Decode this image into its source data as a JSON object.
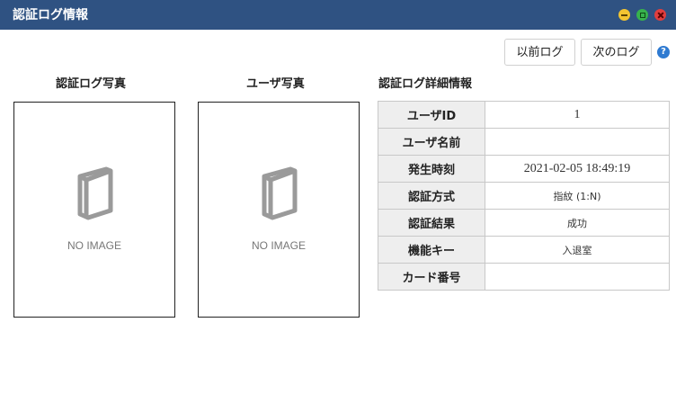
{
  "window": {
    "title": "認証ログ情報",
    "controls": [
      "minimize-icon",
      "maximize-icon",
      "close-icon"
    ]
  },
  "toolbar": {
    "prev_label": "以前ログ",
    "next_label": "次のログ",
    "help_label": "?"
  },
  "panels": {
    "auth_photo_title": "認証ログ写真",
    "user_photo_title": "ユーザ写真",
    "detail_title": "認証ログ詳細情報",
    "no_image": "NO IMAGE"
  },
  "details": [
    {
      "label": "ユーザID",
      "value": "1"
    },
    {
      "label": "ユーザ名前",
      "value": ""
    },
    {
      "label": "発生時刻",
      "value": "2021-02-05 18:49:19"
    },
    {
      "label": "認証方式",
      "value": "指紋 (1:N)"
    },
    {
      "label": "認証結果",
      "value": "成功"
    },
    {
      "label": "機能キー",
      "value": "入退室"
    },
    {
      "label": "カード番号",
      "value": ""
    }
  ],
  "colors": {
    "titlebar": "#2f5282",
    "label_bg": "#eeeeee",
    "help": "#2e7ad1"
  }
}
